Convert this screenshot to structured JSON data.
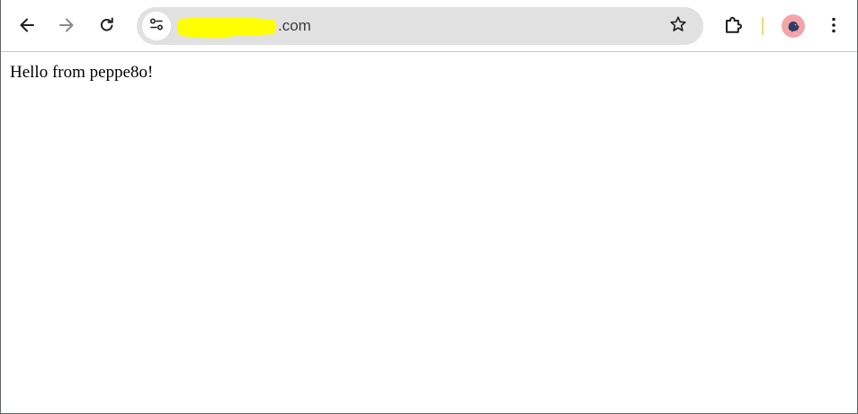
{
  "browser": {
    "toolbar": {
      "back_icon": "arrow-left-icon",
      "forward_icon": "arrow-right-icon",
      "reload_icon": "reload-icon",
      "extensions_icon": "puzzle-piece-icon",
      "menu_icon": "vertical-dots-icon"
    },
    "omnibox": {
      "site_info_icon": "tune-icon",
      "url_domain_suffix": ".com",
      "url_redacted": true,
      "bookmark_icon": "star-outline-icon"
    },
    "profile": {
      "avatar_icon": "profile-avatar"
    }
  },
  "page": {
    "body_text": "Hello from peppe8o!"
  },
  "colors": {
    "toolbar_bg": "#ffffff",
    "omnibox_bg": "#e1e1e1",
    "redaction_highlight": "#ffff00",
    "divider_accent": "#f5d76e",
    "avatar_bg": "#f4a3a8",
    "avatar_figure": "#2a3f63",
    "corner_accent": "#f2c94c",
    "icon_color": "#1f1f1f",
    "icon_disabled": "#8a8a8a"
  }
}
